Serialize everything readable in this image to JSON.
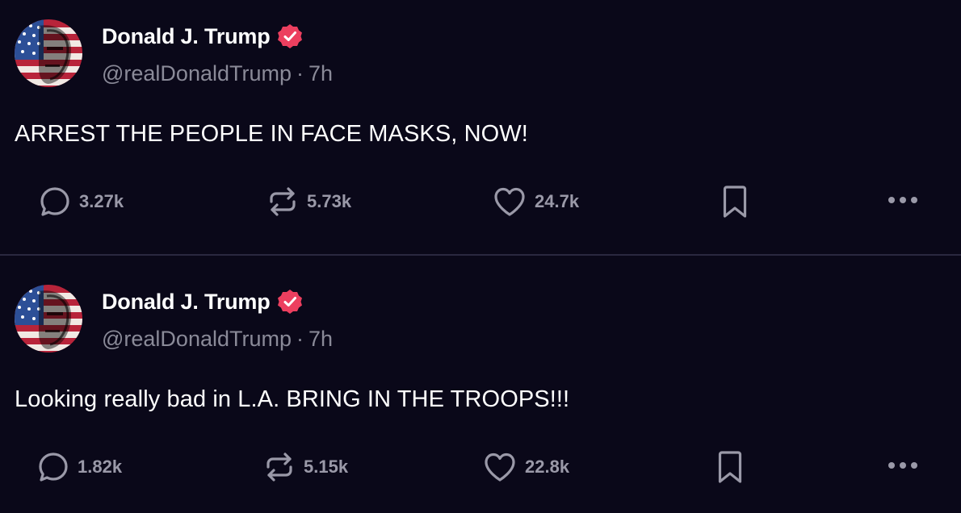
{
  "posts": [
    {
      "author": {
        "name": "Donald J. Trump",
        "handle": "@realDonaldTrump",
        "verified": true,
        "avatar_icon": "avatar-flag-portrait"
      },
      "separator": "·",
      "time": "7h",
      "text": "ARREST THE PEOPLE IN FACE MASKS, NOW!",
      "stats": {
        "replies": "3.27k",
        "reposts": "5.73k",
        "likes": "24.7k"
      }
    },
    {
      "author": {
        "name": "Donald J. Trump",
        "handle": "@realDonaldTrump",
        "verified": true,
        "avatar_icon": "avatar-flag-portrait"
      },
      "separator": "·",
      "time": "7h",
      "text": "Looking really bad in L.A. BRING IN THE TROOPS!!!",
      "stats": {
        "replies": "1.82k",
        "reposts": "5.15k",
        "likes": "22.8k"
      }
    }
  ],
  "icons": [
    "reply-icon",
    "repost-icon",
    "like-icon",
    "bookmark-icon",
    "more-icon",
    "verified-badge-icon"
  ],
  "colors": {
    "background": "#0a0819",
    "text": "#ffffff",
    "muted": "#8a8a98",
    "verified": "#ec3f5f",
    "divider": "#2a2840"
  }
}
